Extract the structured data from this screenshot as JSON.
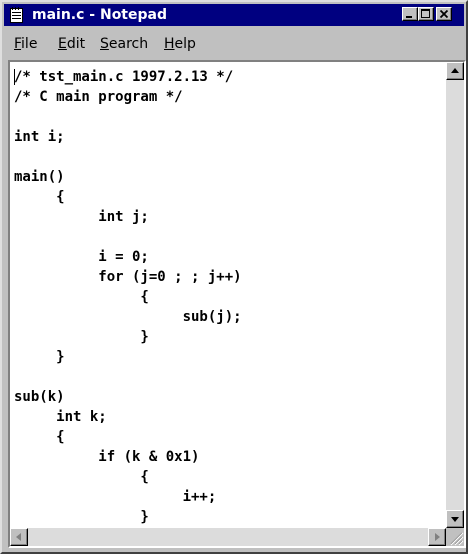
{
  "window": {
    "title": "main.c - Notepad",
    "titlebar_color": "#000080",
    "chrome_color": "#c0c0c0",
    "app_icon": "notepad-icon",
    "controls": {
      "minimize_icon": "minimize-icon",
      "maximize_icon": "maximize-icon",
      "close_icon": "close-icon"
    }
  },
  "menu": {
    "items": [
      {
        "label": "File"
      },
      {
        "label": "Edit"
      },
      {
        "label": "Search"
      },
      {
        "label": "Help"
      }
    ]
  },
  "editor": {
    "lines": [
      "/* tst_main.c 1997.2.13 */",
      "/* C main program */",
      "",
      "int i;",
      "",
      "main()",
      "     {",
      "          int j;",
      "",
      "          i = 0;",
      "          for (j=0 ; ; j++)",
      "               {",
      "                    sub(j);",
      "               }",
      "     }",
      "",
      "sub(k)",
      "     int k;",
      "     {",
      "          if (k & 0x1)",
      "               {",
      "                    i++;",
      "               }"
    ]
  },
  "scrollbars": {
    "vertical": {
      "up_icon": "scroll-up-arrow-icon",
      "down_icon": "scroll-down-arrow-icon"
    },
    "horizontal": {
      "left_icon": "scroll-left-arrow-icon",
      "right_icon": "scroll-right-arrow-icon"
    },
    "size_grip_icon": "size-grip-icon"
  }
}
